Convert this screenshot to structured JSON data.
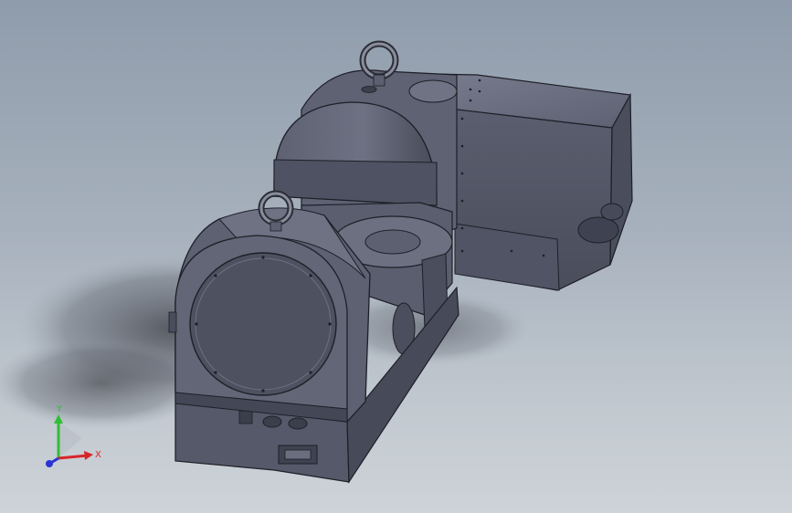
{
  "viewport": {
    "background_top": "#8f9cab",
    "background_bottom": "#cdd3d8"
  },
  "model": {
    "name": "rotary-tilting-table",
    "body_color": "#565a6a",
    "body_light": "#6b6f80",
    "body_dark": "#3f4251",
    "edge_color": "#1e1f27"
  },
  "triad": {
    "x_label": "X",
    "y_label": "Y",
    "x_color": "#d8252a",
    "y_color": "#2fbf35",
    "z_color": "#2a35d4"
  }
}
